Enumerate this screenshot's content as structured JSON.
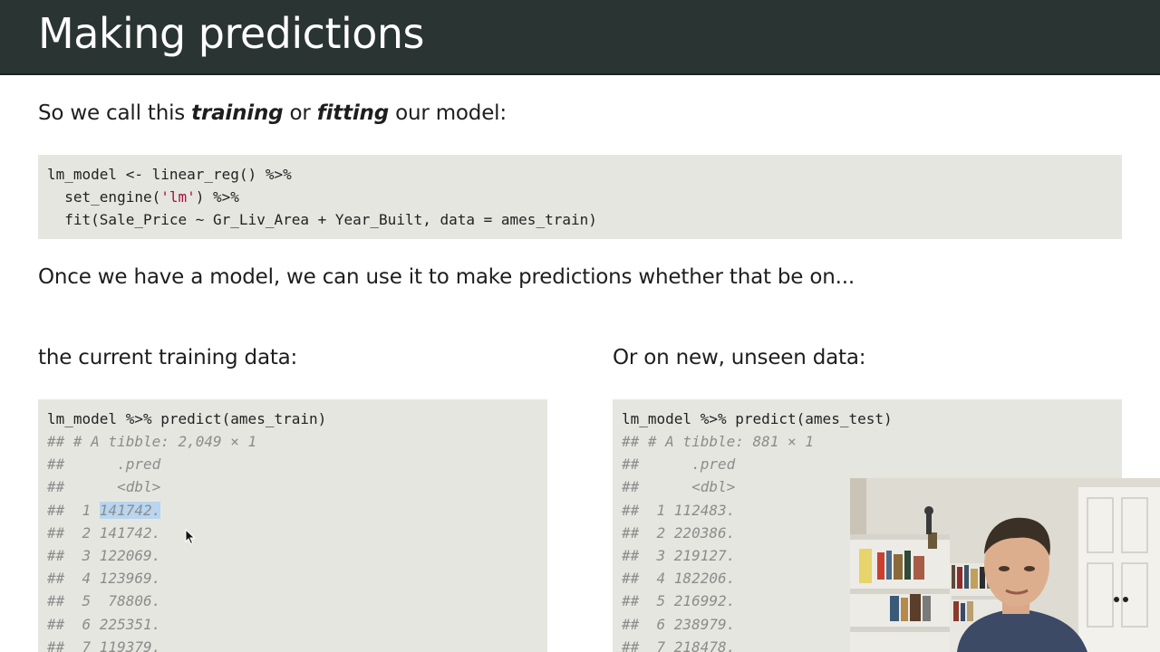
{
  "slide": {
    "title": "Making predictions",
    "intro": {
      "before": "So we call this ",
      "term1": "training",
      "middle": " or ",
      "term2": "fitting",
      "after": " our model:"
    },
    "fit_code": {
      "line1": "lm_model <- linear_reg() %>%",
      "line2_pre": "  set_engine(",
      "line2_str": "'lm'",
      "line2_post": ") %>%",
      "line3": "  fit(Sale_Price ~ Gr_Liv_Area + Year_Built, data = ames_train)"
    },
    "predictions_text": "Once we have a model, we can use it to make predictions whether that be on...",
    "left": {
      "heading": "the current training data:",
      "command": "lm_model %>% predict(ames_train)",
      "tibble_line": "## # A tibble: 2,049 × 1",
      "col_line": "##      .pred",
      "type_line": "##      <dbl>",
      "rows": [
        {
          "prefix": "##  1 ",
          "value": "141742."
        },
        {
          "prefix": "##  2 ",
          "value": "141742."
        },
        {
          "prefix": "##  3 ",
          "value": "122069."
        },
        {
          "prefix": "##  4 ",
          "value": "123969."
        },
        {
          "prefix": "##  5 ",
          "value": " 78806."
        },
        {
          "prefix": "##  6 ",
          "value": "225351."
        },
        {
          "prefix": "##  7 ",
          "value": "119379."
        }
      ]
    },
    "right": {
      "heading": "Or on new, unseen data:",
      "command": "lm_model %>% predict(ames_test)",
      "tibble_line": "## # A tibble: 881 × 1",
      "col_line": "##      .pred",
      "type_line": "##      <dbl>",
      "rows": [
        {
          "prefix": "##  1 ",
          "value": "112483."
        },
        {
          "prefix": "##  2 ",
          "value": "220386."
        },
        {
          "prefix": "##  3 ",
          "value": "219127."
        },
        {
          "prefix": "##  4 ",
          "value": "182206."
        },
        {
          "prefix": "##  5 ",
          "value": "216992."
        },
        {
          "prefix": "##  6 ",
          "value": "238979."
        },
        {
          "prefix": "##  7 ",
          "value": "218478."
        }
      ]
    }
  },
  "colors": {
    "title_bar": "#2a3432",
    "code_bg": "#e6e6e1",
    "string": "#a3123a",
    "comment": "#8c8c8c",
    "selection": "#b9d5ef"
  }
}
